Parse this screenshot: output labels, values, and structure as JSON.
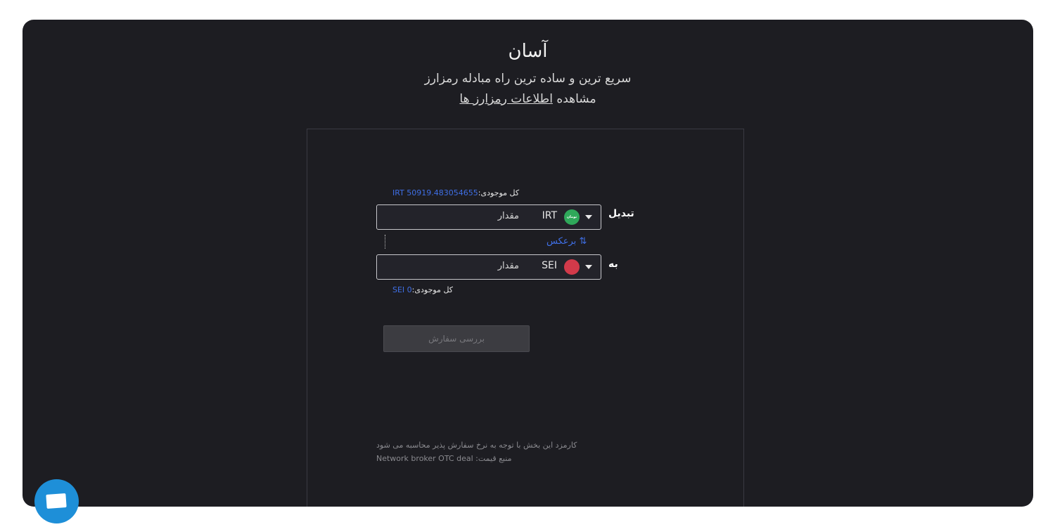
{
  "header": {
    "title": "آسان",
    "subtitle": "سریع ترین و ساده ترین راه مبادله رمزارز",
    "info_prefix": "مشاهده",
    "info_link": "اطلاعات رمزارز ها"
  },
  "form": {
    "from": {
      "label": "تبدیل",
      "balance_label": "کل موجودی:",
      "balance_value": "IRT 50919.483054655",
      "amount_placeholder": "مقدار",
      "currency": "IRT",
      "coin_icon_text": "تومان"
    },
    "swap_label": "برعکس",
    "swap_icon": "⇅",
    "to": {
      "label": "به",
      "balance_label": "کل موجودی:",
      "balance_value": "SEI 0",
      "amount_placeholder": "مقدار",
      "currency": "SEI"
    },
    "submit_label": "بررسی سفارش",
    "fee_note": "کارمزد این بخش با توجه به نرخ سفارش پذیر محاسبه می شود",
    "price_source_label": "منبع قیمت:",
    "price_source_value": "Network broker OTC deal"
  },
  "colors": {
    "background": "#1d1d22",
    "accent": "#3f6fe6",
    "submit_disabled": "#3c3c41"
  }
}
